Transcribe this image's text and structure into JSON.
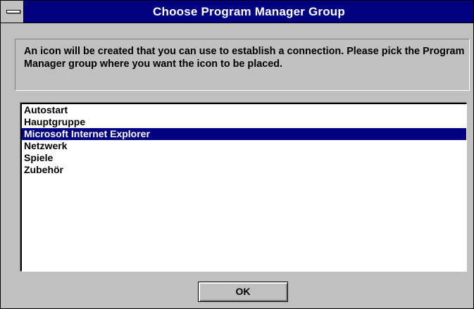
{
  "window": {
    "title": "Choose Program Manager Group",
    "system_menu_icon": "system-menu-dash-icon"
  },
  "message": {
    "text": "An icon will be created that you can use to establish a connection. Please pick the Program Manager group where you want the icon to be placed."
  },
  "groups": {
    "items": [
      {
        "label": "Autostart"
      },
      {
        "label": "Hauptgruppe"
      },
      {
        "label": "Microsoft Internet Explorer"
      },
      {
        "label": "Netzwerk"
      },
      {
        "label": "Spiele"
      },
      {
        "label": "Zubehör"
      }
    ],
    "selected_index": 2
  },
  "buttons": {
    "ok_label": "OK"
  },
  "colors": {
    "title_bar": "#000080",
    "selection": "#000080",
    "dialog_face": "#c0c0c0"
  }
}
